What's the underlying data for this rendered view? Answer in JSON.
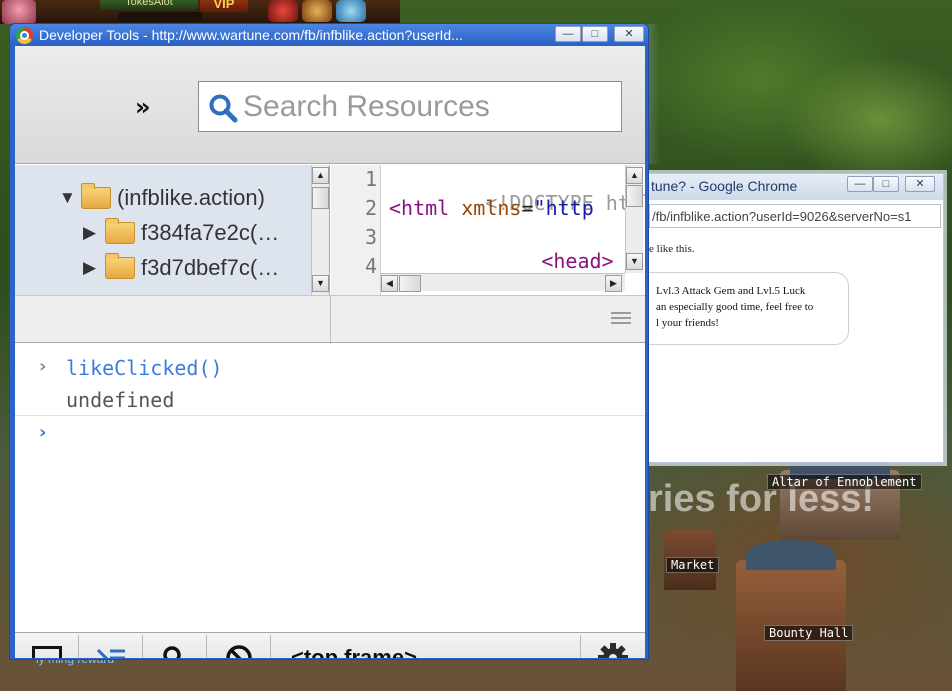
{
  "game": {
    "player_name": "TokesAlot",
    "vip_label": "VIP",
    "building_labels": [
      "Altar of Ennoblement",
      "Market",
      "Bounty Hall"
    ],
    "promo_text": "ries for less!",
    "bottom_text": "ly ming reward"
  },
  "chrome_popup": {
    "title": "tune? - Google Chrome",
    "url": "/fb/infblike.action?userId=9026&serverNo=s1",
    "like_text": "e like this.",
    "message_lines": [
      "Lvl.3 Attack Gem and Lvl.5 Luck",
      "an especially good time, feel free to",
      "l your friends!"
    ],
    "window_buttons": [
      "—",
      "□",
      "✕"
    ]
  },
  "devtools": {
    "title": "Developer Tools - http://www.wartune.com/fb/infblike.action?userId...",
    "window_buttons": [
      "—",
      "□",
      "✕"
    ],
    "overflow_chevron": "»",
    "search": {
      "placeholder": "Search Resources",
      "value": ""
    },
    "tree": [
      {
        "arrow": "▼",
        "label": "(infblike.action)"
      },
      {
        "arrow": "▶",
        "label": "f384fa7e2c(…"
      },
      {
        "arrow": "▶",
        "label": "f3d7dbef7c(…"
      }
    ],
    "source": {
      "line_numbers": [
        "1",
        "2",
        "3",
        "4"
      ],
      "line1": {
        "doctype": "<!DOCTYPE html PU"
      },
      "line2": {
        "open": "<html",
        "attr": "xmlns",
        "eq": "=",
        "value": "\"http"
      },
      "line3": {
        "tag": "<head>"
      }
    },
    "console": {
      "command": "likeClicked()",
      "result": "undefined",
      "prompt_chevron": "›",
      "cmd_chevron": "›"
    },
    "statusbar": {
      "frame_selector": "<top frame>"
    }
  },
  "colors": {
    "console_blue": "#3d7be0",
    "titlebar_blue": "#2a5fc4",
    "tag_purple": "#881280"
  }
}
